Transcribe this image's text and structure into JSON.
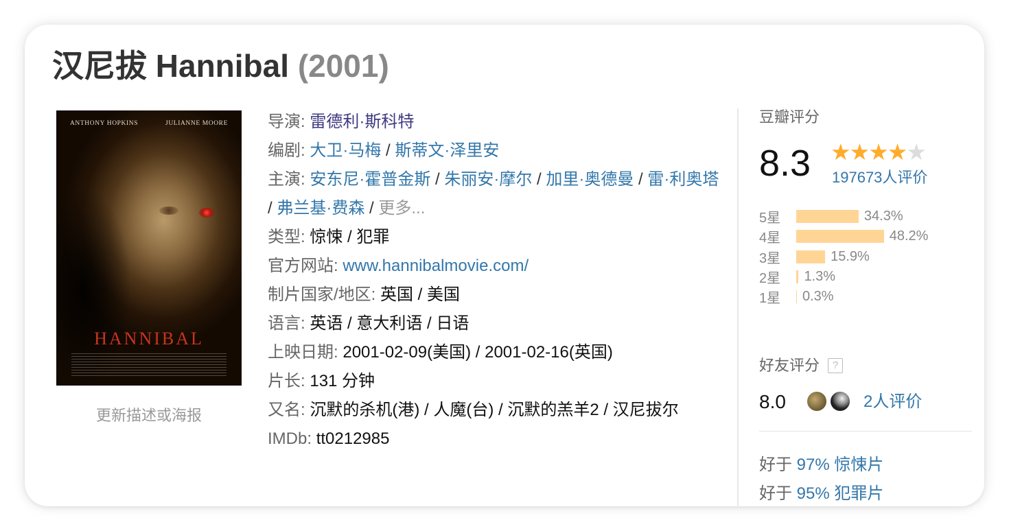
{
  "movie": {
    "title_cn": "汉尼拔",
    "title_en": "Hannibal",
    "year": "(2001)"
  },
  "poster": {
    "top_credit_1": "ANTHONY HOPKINS",
    "top_credit_2": "JULIANNE MOORE",
    "poster_title": "HANNIBAL"
  },
  "update_link": "更新描述或海报",
  "info": {
    "director_label": "导演",
    "directors": [
      "雷德利·斯科特"
    ],
    "writer_label": "编剧",
    "writers": [
      "大卫·马梅",
      "斯蒂文·泽里安"
    ],
    "cast_label": "主演",
    "cast": [
      "安东尼·霍普金斯",
      "朱丽安·摩尔",
      "加里·奥德曼",
      "雷·利奥塔",
      "弗兰基·费森"
    ],
    "more": "更多...",
    "genre_label": "类型",
    "genres": [
      "惊悚",
      "犯罪"
    ],
    "website_label": "官方网站",
    "website": "www.hannibalmovie.com/",
    "country_label": "制片国家/地区",
    "countries": "英国 / 美国",
    "language_label": "语言",
    "languages": "英语 / 意大利语 / 日语",
    "release_label": "上映日期",
    "release": "2001-02-09(美国) / 2001-02-16(英国)",
    "runtime_label": "片长",
    "runtime": "131 分钟",
    "aka_label": "又名",
    "aka": "沉默的杀机(港) / 人魔(台) / 沉默的羔羊2 / 汉尼拔尔",
    "imdb_label": "IMDb",
    "imdb": "tt0212985"
  },
  "rating": {
    "title": "豆瓣评分",
    "score": "8.3",
    "stars": 4,
    "votes": "197673人评价",
    "distribution": [
      {
        "label": "5星",
        "percent": 34.3,
        "text": "34.3%"
      },
      {
        "label": "4星",
        "percent": 48.2,
        "text": "48.2%"
      },
      {
        "label": "3星",
        "percent": 15.9,
        "text": "15.9%"
      },
      {
        "label": "2星",
        "percent": 1.3,
        "text": "1.3%"
      },
      {
        "label": "1星",
        "percent": 0.3,
        "text": "0.3%"
      }
    ],
    "friends_title": "好友评分",
    "friends_help": "?",
    "friends_score": "8.0",
    "friends_votes": "2人评价",
    "better_than": [
      {
        "prefix": "好于",
        "value": "97% 惊悚片"
      },
      {
        "prefix": "好于",
        "value": "95% 犯罪片"
      }
    ]
  },
  "colors": {
    "link": "#3377aa",
    "star": "#ffac2d",
    "bar": "#ffd596"
  }
}
